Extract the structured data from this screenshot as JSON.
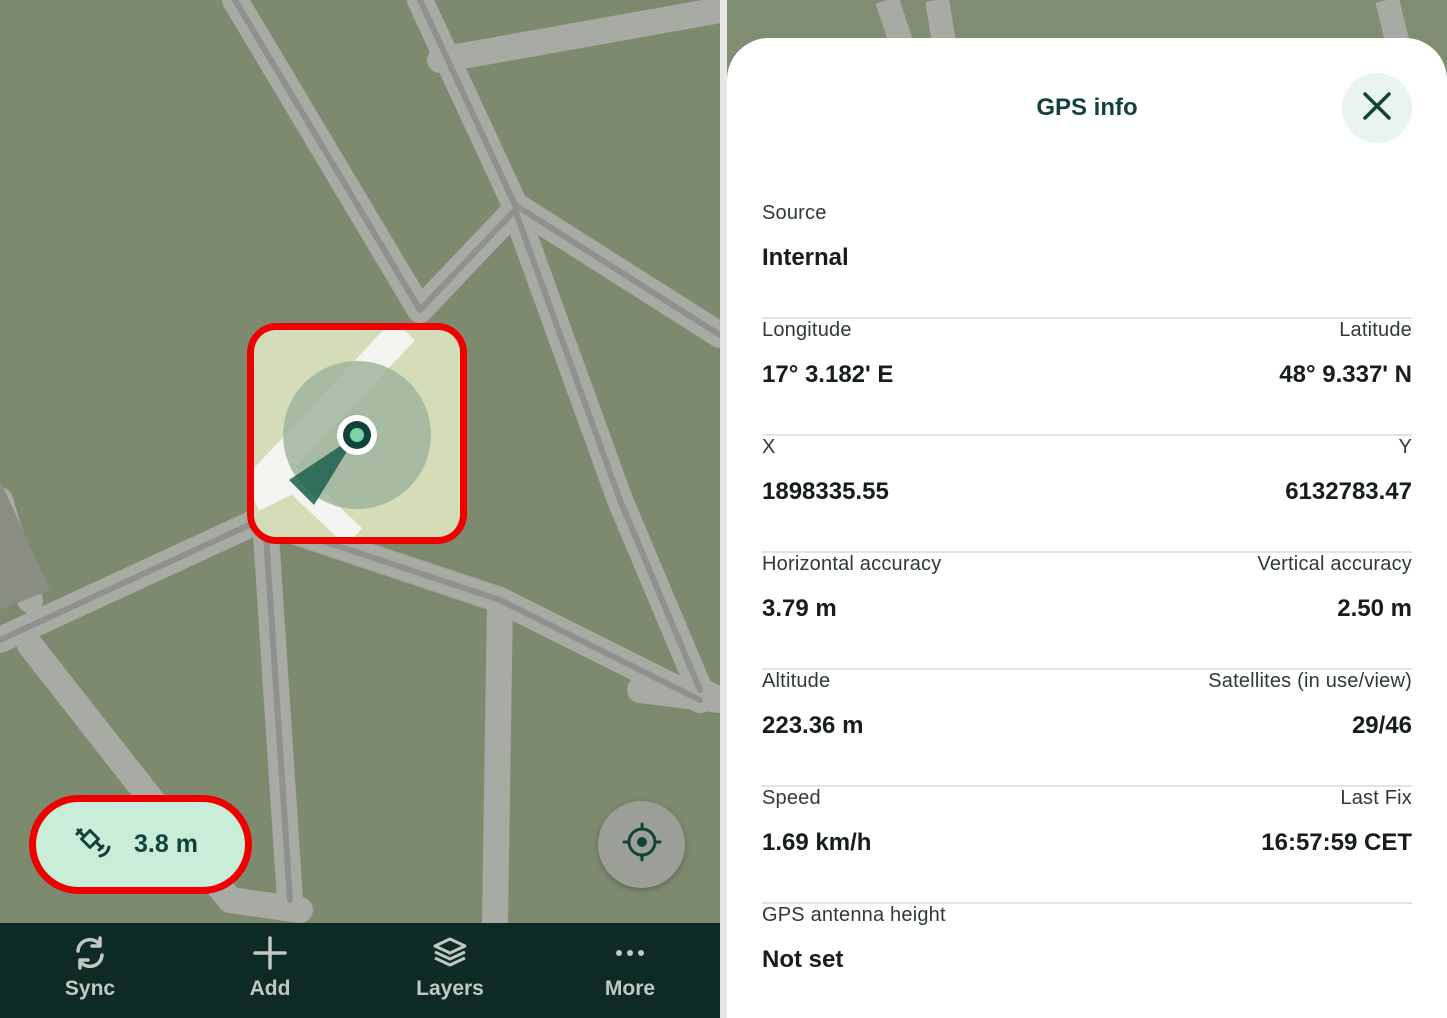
{
  "bottom_nav": {
    "items": [
      {
        "label": "Sync",
        "icon": "sync-icon"
      },
      {
        "label": "Add",
        "icon": "plus-icon"
      },
      {
        "label": "Layers",
        "icon": "layers-icon"
      },
      {
        "label": "More",
        "icon": "more-icon"
      }
    ]
  },
  "gps_status": {
    "accuracy": "3.8 m",
    "icon": "satellite-icon"
  },
  "gps_info": {
    "title": "GPS info",
    "close_icon": "close-icon",
    "source": {
      "label": "Source",
      "value": "Internal"
    },
    "longitude": {
      "label": "Longitude",
      "value": "17° 3.182' E"
    },
    "latitude": {
      "label": "Latitude",
      "value": "48° 9.337' N"
    },
    "x": {
      "label": "X",
      "value": "1898335.55"
    },
    "y": {
      "label": "Y",
      "value": "6132783.47"
    },
    "horizontal_accuracy": {
      "label": "Horizontal accuracy",
      "value": "3.79 m"
    },
    "vertical_accuracy": {
      "label": "Vertical accuracy",
      "value": "2.50 m"
    },
    "altitude": {
      "label": "Altitude",
      "value": "223.36 m"
    },
    "satellites": {
      "label": "Satellites (in use/view)",
      "value": "29/46"
    },
    "speed": {
      "label": "Speed",
      "value": "1.69 km/h"
    },
    "last_fix": {
      "label": "Last Fix",
      "value": "16:57:59 CET"
    },
    "antenna_height": {
      "label": "GPS antenna height",
      "value": "Not set"
    }
  },
  "colors": {
    "map_green": "#7d8a6e",
    "road": "#9e9e9a",
    "accent_dark": "#12433a",
    "pill_bg": "#c8eeda",
    "highlight": "#ee0000",
    "nav_bg": "#0d2a25"
  }
}
